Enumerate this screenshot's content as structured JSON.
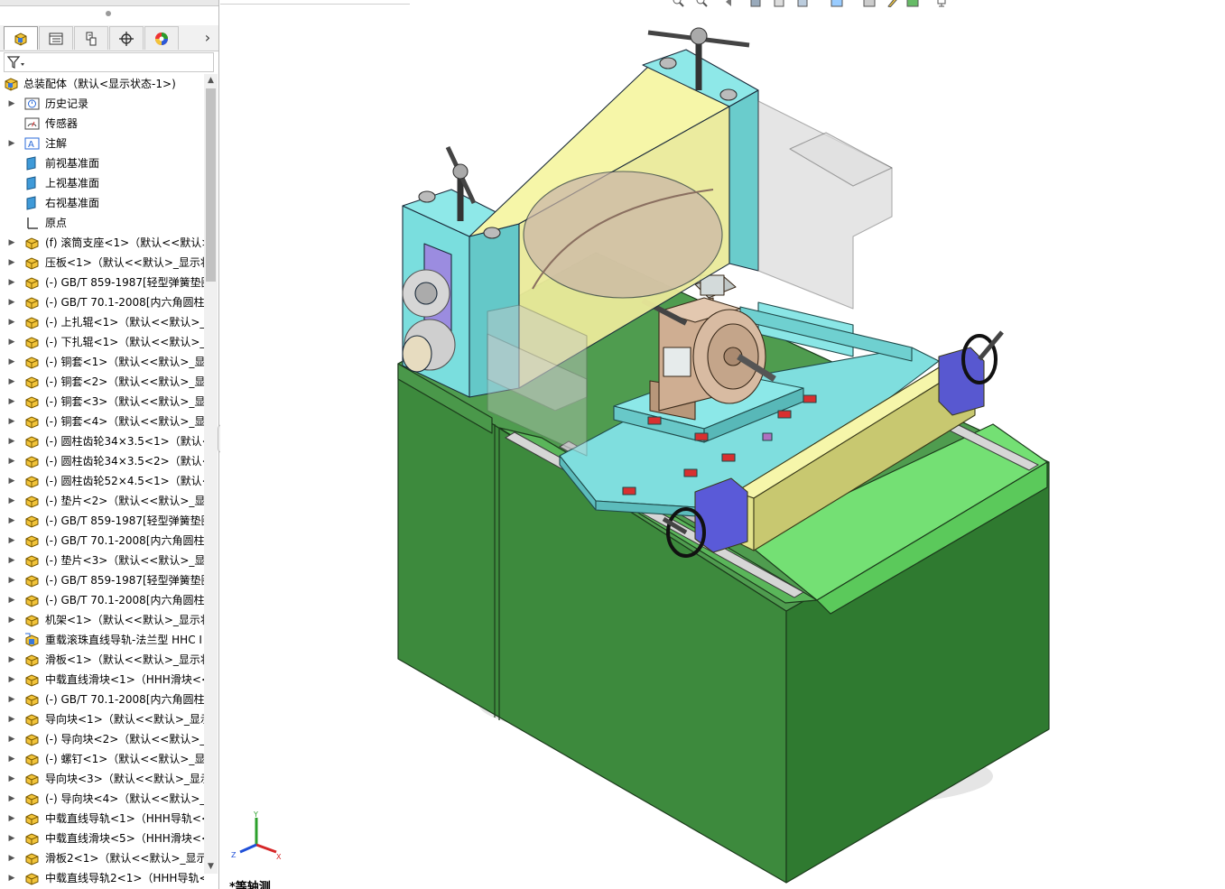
{
  "feature_tree": {
    "root": {
      "label": "总装配体（默认<显示状态-1>)",
      "icon": "assembly-icon"
    },
    "items": [
      {
        "label": "历史记录",
        "icon": "history-icon",
        "expandable": true
      },
      {
        "label": "传感器",
        "icon": "sensor-icon",
        "expandable": false
      },
      {
        "label": "注解",
        "icon": "annotation-icon",
        "expandable": true
      },
      {
        "label": "前视基准面",
        "icon": "plane-icon",
        "expandable": false
      },
      {
        "label": "上视基准面",
        "icon": "plane-icon",
        "expandable": false
      },
      {
        "label": "右视基准面",
        "icon": "plane-icon",
        "expandable": false
      },
      {
        "label": "原点",
        "icon": "origin-icon",
        "expandable": false
      },
      {
        "label": "(f) 滚筒支座<1>（默认<<默认>_",
        "icon": "part-icon",
        "expandable": true
      },
      {
        "label": "压板<1>（默认<<默认>_显示状",
        "icon": "part-icon",
        "expandable": true
      },
      {
        "label": "(-) GB/T 859-1987[轻型弹簧垫圈",
        "icon": "part-icon",
        "expandable": true
      },
      {
        "label": "(-) GB/T 70.1-2008[内六角圆柱",
        "icon": "part-icon",
        "expandable": true
      },
      {
        "label": "(-) 上扎辊<1>（默认<<默认>_显",
        "icon": "part-icon",
        "expandable": true
      },
      {
        "label": "(-) 下扎辊<1>（默认<<默认>_显",
        "icon": "part-icon",
        "expandable": true
      },
      {
        "label": "(-) 铜套<1>（默认<<默认>_显示",
        "icon": "part-icon",
        "expandable": true
      },
      {
        "label": "(-) 铜套<2>（默认<<默认>_显示",
        "icon": "part-icon",
        "expandable": true
      },
      {
        "label": "(-) 铜套<3>（默认<<默认>_显示",
        "icon": "part-icon",
        "expandable": true
      },
      {
        "label": "(-) 铜套<4>（默认<<默认>_显示",
        "icon": "part-icon",
        "expandable": true
      },
      {
        "label": "(-) 圆柱齿轮34×3.5<1>（默认<",
        "icon": "part-icon",
        "expandable": true
      },
      {
        "label": "(-) 圆柱齿轮34×3.5<2>（默认<",
        "icon": "part-icon",
        "expandable": true
      },
      {
        "label": "(-) 圆柱齿轮52×4.5<1>（默认<",
        "icon": "part-icon",
        "expandable": true
      },
      {
        "label": "(-) 垫片<2>（默认<<默认>_显示",
        "icon": "part-icon",
        "expandable": true
      },
      {
        "label": "(-) GB/T 859-1987[轻型弹簧垫圈",
        "icon": "part-icon",
        "expandable": true
      },
      {
        "label": "(-) GB/T 70.1-2008[内六角圆柱",
        "icon": "part-icon",
        "expandable": true
      },
      {
        "label": "(-) 垫片<3>（默认<<默认>_显示",
        "icon": "part-icon",
        "expandable": true
      },
      {
        "label": "(-) GB/T 859-1987[轻型弹簧垫圈",
        "icon": "part-icon",
        "expandable": true
      },
      {
        "label": "(-) GB/T 70.1-2008[内六角圆柱",
        "icon": "part-icon",
        "expandable": true
      },
      {
        "label": "机架<1>（默认<<默认>_显示状",
        "icon": "part-icon",
        "expandable": true
      },
      {
        "label": "重载滚珠直线导轨-法兰型 HHC I",
        "icon": "subassembly-icon",
        "expandable": true
      },
      {
        "label": "滑板<1>（默认<<默认>_显示状",
        "icon": "part-icon",
        "expandable": true
      },
      {
        "label": "中载直线滑块<1>（HHH滑块<<",
        "icon": "part-icon",
        "expandable": true
      },
      {
        "label": "(-) GB/T 70.1-2008[内六角圆柱",
        "icon": "part-icon",
        "expandable": true
      },
      {
        "label": "导向块<1>（默认<<默认>_显示",
        "icon": "part-icon",
        "expandable": true
      },
      {
        "label": "(-) 导向块<2>（默认<<默认>_显",
        "icon": "part-icon",
        "expandable": true
      },
      {
        "label": "(-) 螺钉<1>（默认<<默认>_显示",
        "icon": "part-icon",
        "expandable": true
      },
      {
        "label": "导向块<3>（默认<<默认>_显示",
        "icon": "part-icon",
        "expandable": true
      },
      {
        "label": "(-) 导向块<4>（默认<<默认>_显",
        "icon": "part-icon",
        "expandable": true
      },
      {
        "label": "中载直线导轨<1>（HHH导轨<<",
        "icon": "part-icon",
        "expandable": true
      },
      {
        "label": "中载直线滑块<5>（HHH滑块<<",
        "icon": "part-icon",
        "expandable": true
      },
      {
        "label": "滑板2<1>（默认<<默认>_显示状",
        "icon": "part-icon",
        "expandable": true
      },
      {
        "label": "中载直线导轨2<1>（HHH导轨<",
        "icon": "part-icon",
        "expandable": true
      }
    ]
  },
  "panel_tabs": [
    {
      "name": "feature-manager",
      "icon": "feature-manager-icon"
    },
    {
      "name": "property-manager",
      "icon": "property-manager-icon"
    },
    {
      "name": "configuration-manager",
      "icon": "configuration-manager-icon"
    },
    {
      "name": "dimxpert-manager",
      "icon": "crosshair-icon"
    },
    {
      "name": "display-manager",
      "icon": "appearance-icon"
    }
  ],
  "triad": {
    "x": "X",
    "y": "Y",
    "z": "Z"
  },
  "view_label": "*等轴测",
  "colors": {
    "frame_green": "#3a7d3a",
    "frame_green_light": "#6fd46f",
    "plate_cyan": "#7fe0e0",
    "roller_yellow": "#f0f0a0",
    "glass_gray": "#cfcfcf",
    "blue_part": "#6a6ad8"
  }
}
